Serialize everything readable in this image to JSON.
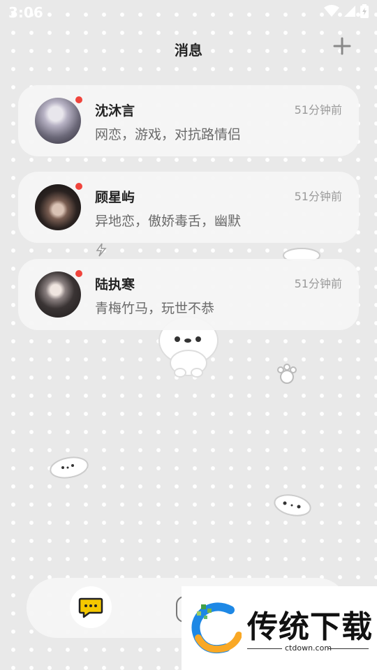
{
  "status": {
    "time": "3:06"
  },
  "header": {
    "title": "消息",
    "add_icon": "plus-icon"
  },
  "conversations": [
    {
      "name": "沈沐言",
      "time": "51分钟前",
      "preview": "网恋，游戏，对抗路情侣",
      "unread": true
    },
    {
      "name": "顾星屿",
      "time": "51分钟前",
      "preview": "异地恋，傲娇毒舌，幽默",
      "unread": true
    },
    {
      "name": "陆执寒",
      "time": "51分钟前",
      "preview": "青梅竹马，玩世不恭",
      "unread": true
    }
  ],
  "bottom_nav": {
    "chat_icon": "chat-bubble-icon"
  },
  "watermark": {
    "text": "传统下载",
    "url": "ctdown.com"
  },
  "colors": {
    "unread_dot": "#f0443c",
    "chat_icon_accent": "#f5c800"
  }
}
